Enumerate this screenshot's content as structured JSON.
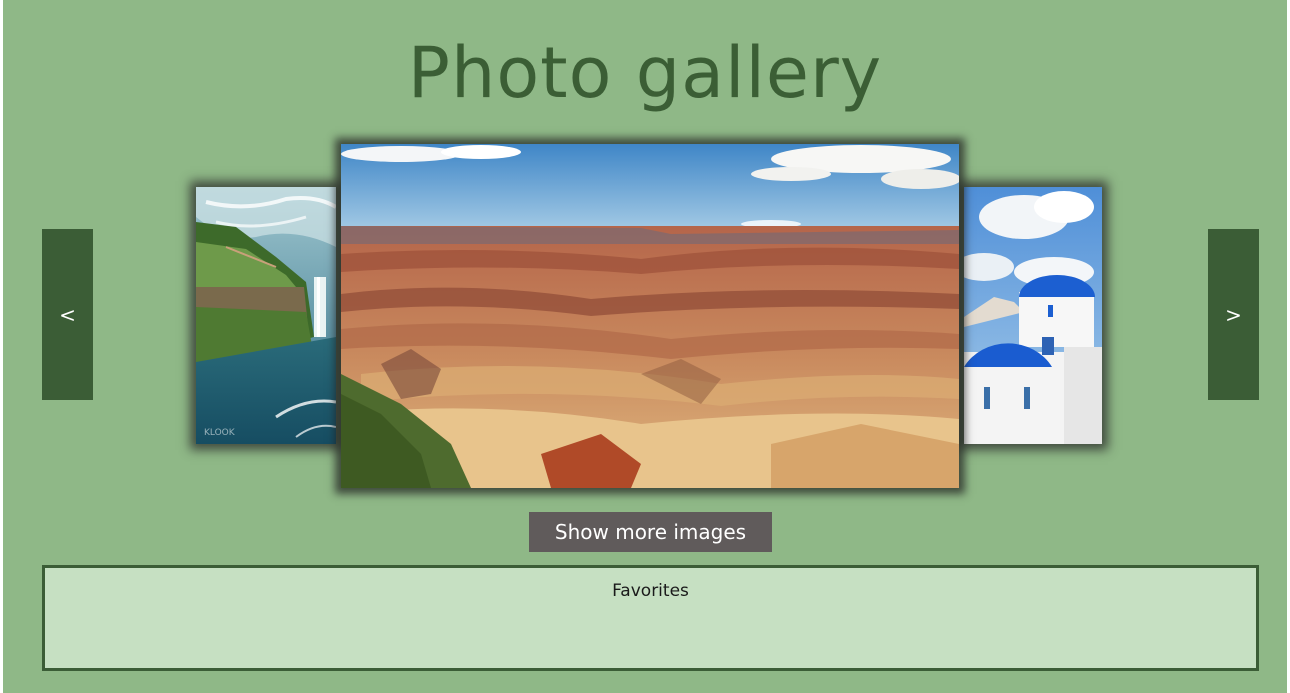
{
  "header": {
    "title": "Photo gallery"
  },
  "carousel": {
    "prev_label": "<",
    "next_label": ">",
    "images": [
      {
        "subject": "waterfall",
        "watermark": "KLOOK"
      },
      {
        "subject": "grand-canyon"
      },
      {
        "subject": "santorini-domes"
      }
    ]
  },
  "actions": {
    "show_more_label": "Show more images"
  },
  "favorites": {
    "title": "Favorites"
  },
  "colors": {
    "background": "#8fb887",
    "accent_dark": "#3b5d36",
    "button_gray": "#605b5b",
    "panel_light": "#c6e0c2"
  }
}
